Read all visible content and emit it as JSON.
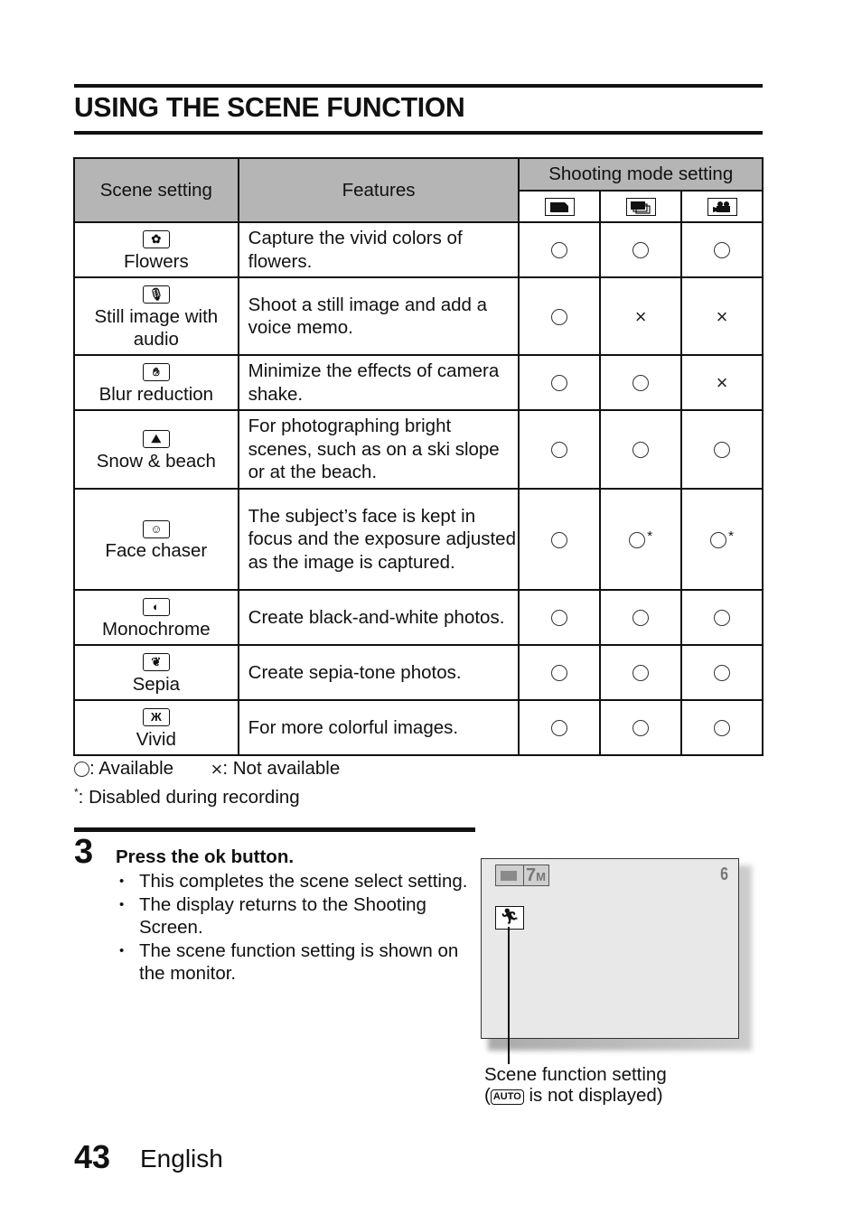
{
  "page": {
    "title": "USING THE SCENE FUNCTION",
    "page_number": "43",
    "language": "English"
  },
  "table": {
    "headers": {
      "scene_setting": "Scene setting",
      "features": "Features",
      "shooting_mode": "Shooting mode setting",
      "modes": [
        {
          "icon": "single-shot-icon"
        },
        {
          "icon": "sequential-shot-icon"
        },
        {
          "icon": "video-camera-icon"
        }
      ]
    },
    "rows": [
      {
        "icon": "flower-icon",
        "name": "Flowers",
        "feature": "Capture the vivid colors of flowers.",
        "marks": [
          "available",
          "available",
          "available"
        ]
      },
      {
        "icon": "microphone-image-icon",
        "name": "Still image with audio",
        "feature": "Shoot a still image and add a voice memo.",
        "marks": [
          "available",
          "not-available",
          "not-available"
        ]
      },
      {
        "icon": "hand-shake-icon",
        "name": "Blur reduction",
        "feature": "Minimize the effects of camera shake.",
        "marks": [
          "available",
          "available",
          "not-available"
        ]
      },
      {
        "icon": "mountain-palm-icon",
        "name": "Snow & beach",
        "feature": "For photographing bright scenes, such as on a ski slope or at the beach.",
        "marks": [
          "available",
          "available",
          "available"
        ]
      },
      {
        "icon": "face-icon",
        "name": "Face chaser",
        "feature": "The subject’s face is kept in focus and the exposure adjusted as the image is captured.",
        "marks": [
          "available",
          "available-disabled-recording",
          "available-disabled-recording"
        ]
      },
      {
        "icon": "half-circle-icon",
        "name": "Monochrome",
        "feature": "Create black-and-white photos.",
        "marks": [
          "available",
          "available",
          "available"
        ]
      },
      {
        "icon": "leaf-icon",
        "name": "Sepia",
        "feature": "Create sepia-tone photos.",
        "marks": [
          "available",
          "available",
          "available"
        ]
      },
      {
        "icon": "butterfly-icon",
        "name": "Vivid",
        "feature": "For more colorful images.",
        "marks": [
          "available",
          "available",
          "available"
        ]
      }
    ]
  },
  "legend": {
    "available": ": Available",
    "not_available": ": Not available",
    "star_symbol": "*",
    "disabled": ":   Disabled during recording"
  },
  "step": {
    "number": "3",
    "title": "Press the ok button.",
    "bullets": [
      "This completes the scene select setting.",
      "The display returns to the Shooting Screen.",
      "The scene function setting is shown on the monitor."
    ]
  },
  "monitor": {
    "resolution": "7",
    "resolution_unit": "M",
    "shots_remaining": "6",
    "scene_icon": "running-person-icon"
  },
  "caption": {
    "line1": "Scene function setting",
    "open_paren": "(",
    "auto_label": "AUTO",
    "line2_rest": " is not displayed)"
  }
}
